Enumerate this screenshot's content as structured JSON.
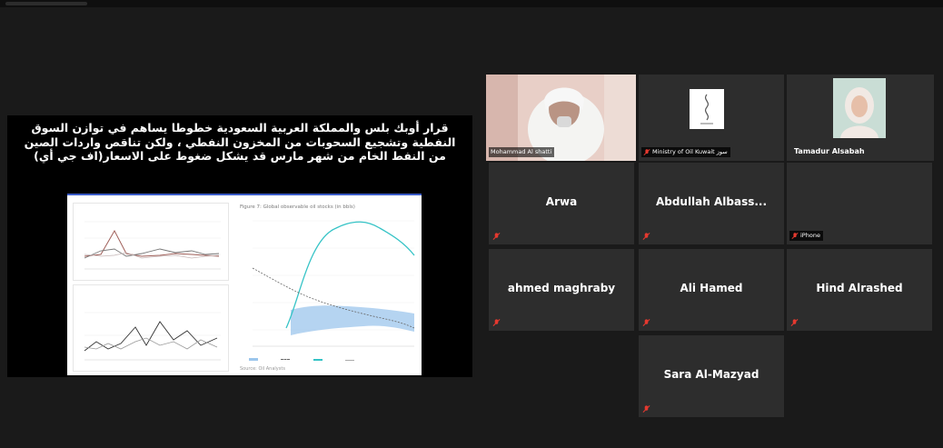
{
  "shared_screen": {
    "headline": "قرار أوبك بلس والمملكة العربية السعودية خطوطا يساهم في توازن السوق النفطية وتشجيع السحوبات من المخزون النفطي ، ولكن تناقص واردات الصين من النفط الخام من شهر مارس قد يشكل ضغوط على الاسعار(اف جي أي)",
    "figure_title": "Figure 7: Global observable oil stocks (in bbls)",
    "source_note": "Source: Oil Analysts",
    "colors": {
      "teal": "#35c3c6",
      "band": "#9cc6ec",
      "brown": "#a0605a",
      "gray": "#8a8a8a"
    }
  },
  "participants": [
    {
      "name": "Mohammed Al shatti",
      "label": "Mohammad Al shatti",
      "type": "video-man",
      "muted": false,
      "speaking": true
    },
    {
      "name": "Ministry of Oil Kuwait",
      "label": "Ministry of Oil Kuwait سوز",
      "type": "logo",
      "muted": true
    },
    {
      "name": "Tamadur Alsabah",
      "label": "Tamadur Alsabah",
      "type": "photo",
      "muted": false
    },
    {
      "name": "Arwa",
      "muted": true
    },
    {
      "name": "Abdullah Albass...",
      "muted": true
    },
    {
      "name": "",
      "label": "iPhone",
      "muted": true
    },
    {
      "name": "ahmed maghraby",
      "muted": true
    },
    {
      "name": "Ali Hamed",
      "muted": true
    },
    {
      "name": "Hind Alrashed",
      "muted": true
    },
    {
      "name": "Sara Al-Mazyad",
      "muted": true
    }
  ]
}
